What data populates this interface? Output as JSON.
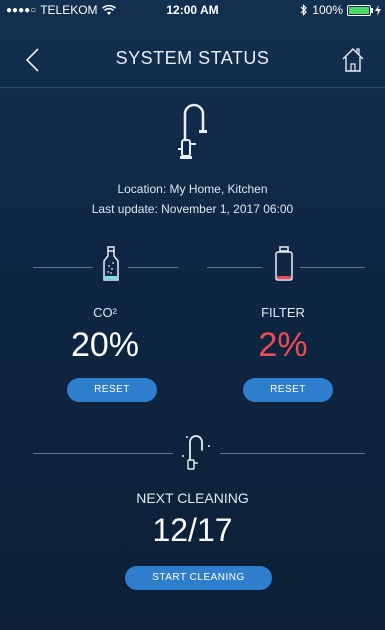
{
  "status_bar": {
    "signal_dots": "●●●●○",
    "carrier": "TELEKOM",
    "time": "12:00 AM",
    "battery": "100%",
    "battery_level": 1.0
  },
  "header": {
    "title": "SYSTEM STATUS",
    "back_icon": "chevron-left-icon",
    "home_icon": "home-icon"
  },
  "device": {
    "location": "Location: My Home, Kitchen",
    "last_update": "Last update: November 1, 2017 06:00"
  },
  "co2": {
    "label": "CO²",
    "value": "20%",
    "button": "RESET",
    "icon": "bottle-icon"
  },
  "filter": {
    "label": "FILTER",
    "value": "2%",
    "button": "RESET",
    "icon": "filter-icon",
    "value_color": "#ee4a55"
  },
  "cleaning": {
    "label": "NEXT CLEANING",
    "value": "12/17",
    "button": "START CLEANING",
    "icon": "faucet-sparkle-icon"
  },
  "colors": {
    "background": "#0f2744",
    "accent": "#2f7ecd",
    "alert": "#ee4a55"
  }
}
